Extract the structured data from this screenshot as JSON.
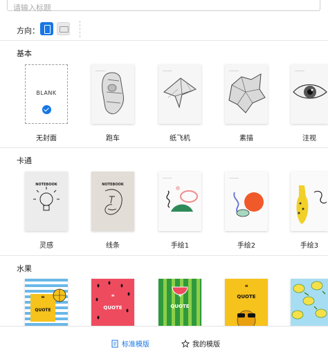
{
  "search": {
    "placeholder": "请输入标题"
  },
  "orientation": {
    "label": "方向：",
    "options": [
      "portrait",
      "landscape"
    ],
    "selected": "portrait"
  },
  "accent_color": "#1677e5",
  "sections": [
    {
      "title": "基本",
      "items": [
        {
          "label": "无封面",
          "text": "BLANK",
          "selected": true
        },
        {
          "label": "跑车"
        },
        {
          "label": "纸飞机"
        },
        {
          "label": "素描"
        },
        {
          "label": "注视"
        }
      ]
    },
    {
      "title": "卡通",
      "items": [
        {
          "label": "灵感",
          "text": "NOTEBOOK"
        },
        {
          "label": "线条",
          "text": "NOTEBOOK"
        },
        {
          "label": "手绘1"
        },
        {
          "label": "手绘2"
        },
        {
          "label": "手绘3"
        }
      ]
    },
    {
      "title": "水果",
      "items": [
        {
          "text": "QUOTE"
        },
        {
          "text": "QUOTE"
        },
        {
          "text": "QUOTE"
        },
        {
          "text": "QUOTE"
        },
        {
          "text": ""
        }
      ]
    }
  ],
  "tabs": {
    "standard": "标准模版",
    "mine": "我的模版"
  }
}
